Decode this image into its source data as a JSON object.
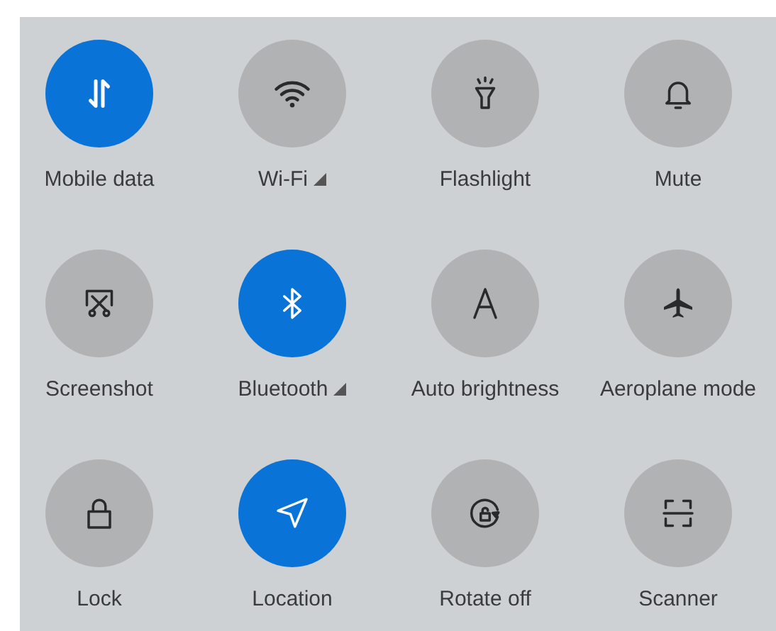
{
  "tiles": [
    {
      "kind": "mobile-data",
      "label": "Mobile data",
      "on": true,
      "expandable": false
    },
    {
      "kind": "wifi",
      "label": "Wi-Fi",
      "on": false,
      "expandable": true
    },
    {
      "kind": "flashlight",
      "label": "Flashlight",
      "on": false,
      "expandable": false
    },
    {
      "kind": "mute",
      "label": "Mute",
      "on": false,
      "expandable": false
    },
    {
      "kind": "screenshot",
      "label": "Screenshot",
      "on": false,
      "expandable": false
    },
    {
      "kind": "bluetooth",
      "label": "Bluetooth",
      "on": true,
      "expandable": true
    },
    {
      "kind": "auto-brightness",
      "label": "Auto brightness",
      "on": false,
      "expandable": false
    },
    {
      "kind": "aeroplane",
      "label": "Aeroplane mode",
      "on": false,
      "expandable": false
    },
    {
      "kind": "lock",
      "label": "Lock",
      "on": false,
      "expandable": false
    },
    {
      "kind": "location",
      "label": "Location",
      "on": true,
      "expandable": false
    },
    {
      "kind": "rotate",
      "label": "Rotate off",
      "on": false,
      "expandable": false
    },
    {
      "kind": "scanner",
      "label": "Scanner",
      "on": false,
      "expandable": false
    }
  ]
}
